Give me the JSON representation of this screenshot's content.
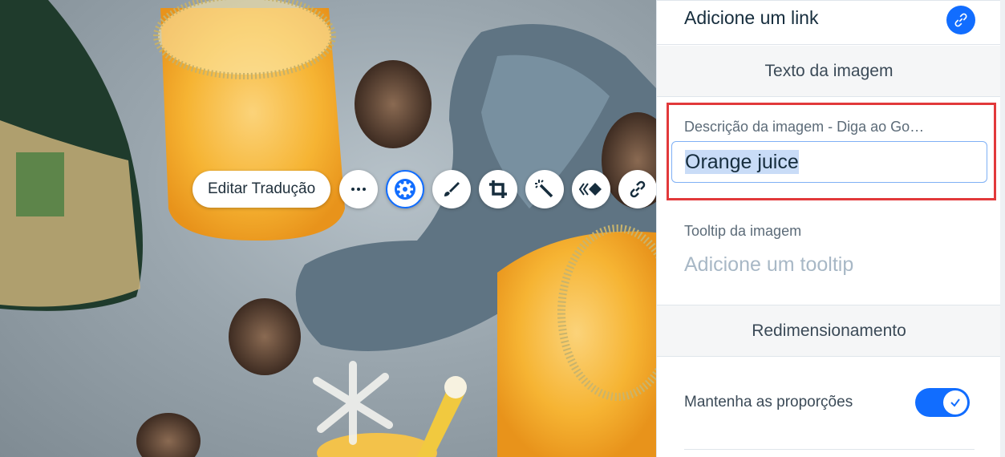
{
  "toolbar": {
    "edit_translation": "Editar Tradução",
    "tools": [
      "more-icon",
      "settings-icon",
      "brush-icon",
      "crop-icon",
      "magic-wand-icon",
      "animation-icon",
      "link-icon"
    ]
  },
  "panel": {
    "link_row": {
      "label": "Adicione um link",
      "icon": "link-icon"
    },
    "image_text_section": "Texto da imagem",
    "description": {
      "label": "Descrição da imagem - Diga ao Go…",
      "value": "Orange juice"
    },
    "tooltip": {
      "label": "Tooltip da imagem",
      "placeholder": "Adicione um tooltip"
    },
    "resize_section": "Redimensionamento",
    "keep_ratio": {
      "label": "Mantenha as proporções",
      "checked": true
    }
  },
  "colors": {
    "accent": "#116dff",
    "highlight_border": "#e2393b"
  }
}
